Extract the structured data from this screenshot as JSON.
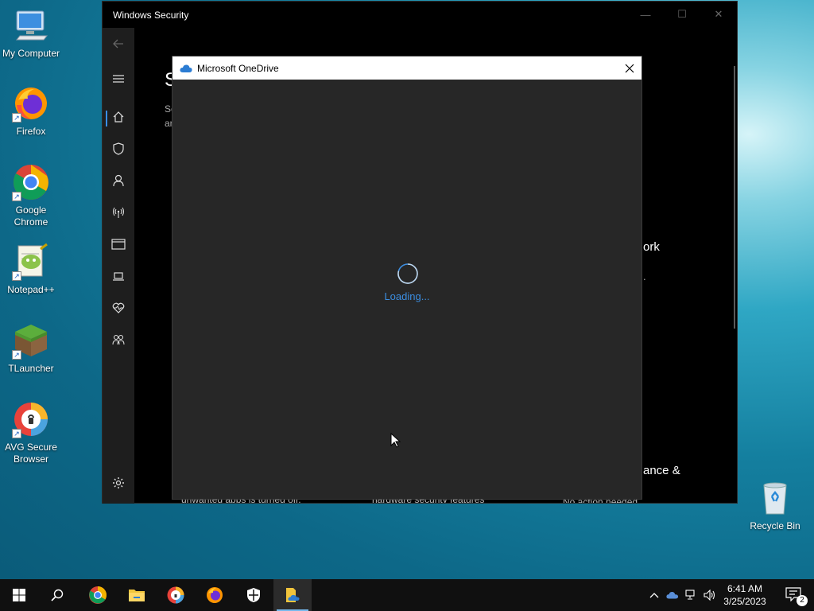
{
  "desktop": {
    "icons": [
      {
        "label": "My Computer"
      },
      {
        "label": "Firefox"
      },
      {
        "label": "Google Chrome"
      },
      {
        "label": "Notepad++"
      },
      {
        "label": "TLauncher"
      },
      {
        "label": "AVG Secure Browser"
      },
      {
        "label": "Recycle Bin"
      }
    ]
  },
  "security_window": {
    "title": "Windows Security",
    "nav_icons": [
      "back-arrow-icon",
      "hamburger-menu-icon",
      "home-icon",
      "shield-icon",
      "person-icon",
      "wifi-antenna-icon",
      "browser-window-icon",
      "laptop-icon",
      "heart-pulse-icon",
      "family-icon",
      "gear-icon"
    ],
    "heading_fragment": "S",
    "desc_fragment_1": "Se",
    "desc_fragment_2": "ar",
    "right_fragment_1": "ork",
    "right_fragment_2": ".",
    "right_fragment_3": "ance &",
    "bottom_text_1": "unwanted apps is turned off.",
    "bottom_text_2": "hardware security features",
    "bottom_text_3": "No action needed."
  },
  "onedrive_dialog": {
    "title": "Microsoft OneDrive",
    "loading_text": "Loading..."
  },
  "taskbar": {
    "apps": [
      "start-icon",
      "search-icon",
      "chrome-icon",
      "file-explorer-icon",
      "avg-browser-icon",
      "firefox-icon",
      "windows-security-icon",
      "onedrive-setup-icon"
    ],
    "time": "6:41 AM",
    "date": "3/25/2023",
    "notification_count": "2"
  },
  "colors": {
    "accent": "#3a8ee6",
    "loading": "#3b8de0"
  }
}
